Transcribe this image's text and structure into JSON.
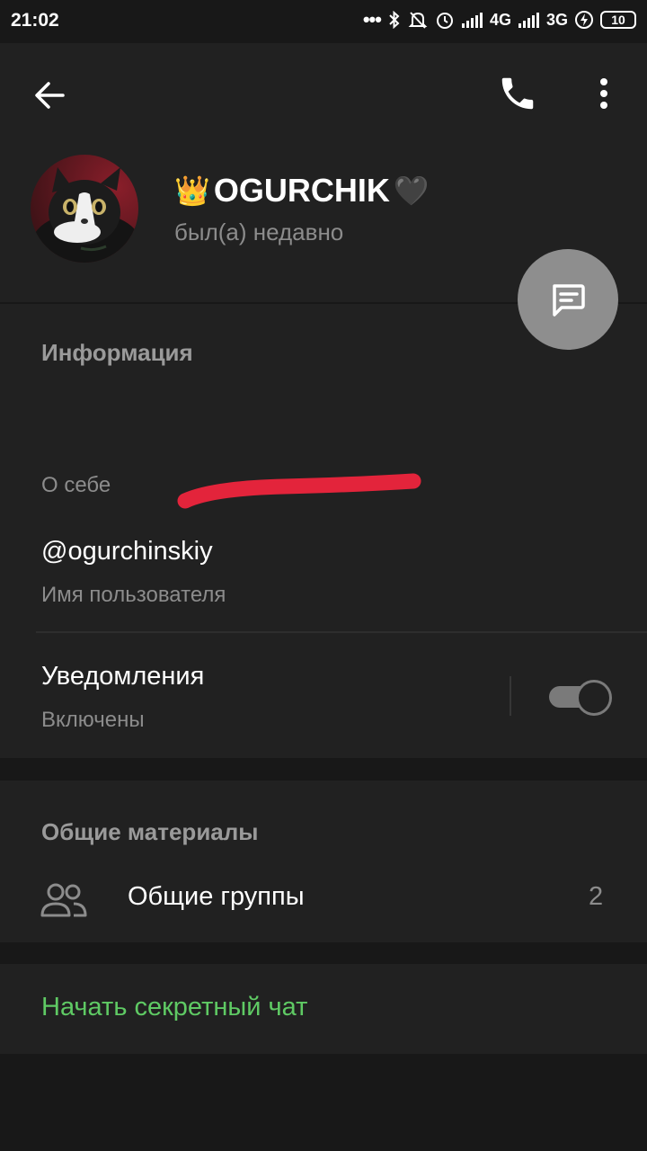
{
  "status_bar": {
    "time": "21:02",
    "dots": "•••",
    "net1": "4G",
    "net2": "3G",
    "battery": "10"
  },
  "header": {
    "name": "OGURCHIK",
    "emoji_left": "👑",
    "emoji_right": "🖤",
    "status": "был(а) недавно",
    "icons": [
      "back-arrow-icon",
      "phone-icon",
      "more-vertical-icon",
      "chat-icon"
    ]
  },
  "info": {
    "section_title": "Информация",
    "bio_caption": "О себе",
    "username": "@ogurchinskiy",
    "username_caption": "Имя пользователя",
    "notifications_label": "Уведомления",
    "notifications_value": "Включены",
    "notifications_enabled": true
  },
  "shared": {
    "section_title": "Общие материалы",
    "groups_label": "Общие группы",
    "groups_count": "2"
  },
  "secret_chat": {
    "label": "Начать секретный чат"
  },
  "colors": {
    "background": "#181818",
    "surface": "#212121",
    "accent_green": "#5fca64",
    "annotation_red": "#e3243b"
  }
}
